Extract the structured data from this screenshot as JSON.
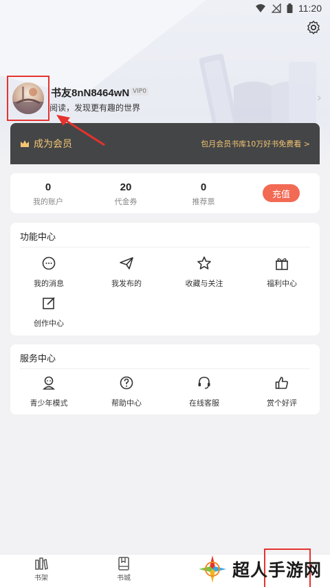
{
  "status_bar": {
    "time": "11:20"
  },
  "profile": {
    "username": "书友8nN8464wN",
    "vip_badge": "VIP0",
    "slogan": "阅读，发现更有趣的世界"
  },
  "vip_banner": {
    "title": "成为会员",
    "promo": "包月会员书库10万好书免费看 >",
    "accent_color": "#f3c672"
  },
  "account": {
    "items": [
      {
        "value": "0",
        "label": "我的账户"
      },
      {
        "value": "20",
        "label": "代金券"
      },
      {
        "value": "0",
        "label": "推荐票"
      }
    ],
    "recharge_label": "充值"
  },
  "functions": {
    "title": "功能中心",
    "items": [
      {
        "label": "我的消息",
        "icon": "message-icon"
      },
      {
        "label": "我发布的",
        "icon": "send-icon"
      },
      {
        "label": "收藏与关注",
        "icon": "star-icon"
      },
      {
        "label": "福利中心",
        "icon": "gift-icon"
      },
      {
        "label": "创作中心",
        "icon": "edit-icon"
      }
    ]
  },
  "services": {
    "title": "服务中心",
    "items": [
      {
        "label": "青少年模式",
        "icon": "teen-icon"
      },
      {
        "label": "帮助中心",
        "icon": "help-icon"
      },
      {
        "label": "在线客服",
        "icon": "headset-icon"
      },
      {
        "label": "赏个好评",
        "icon": "thumbs-up-icon"
      }
    ]
  },
  "bottom_nav": {
    "items": [
      {
        "label": "书架",
        "icon": "bookshelf-icon"
      },
      {
        "label": "书城",
        "icon": "bookstore-icon"
      }
    ]
  },
  "watermark": {
    "text": "超人手游网"
  },
  "colors": {
    "recharge": "#f26954",
    "banner_bg": "#444547",
    "highlight": "#e5322d"
  }
}
